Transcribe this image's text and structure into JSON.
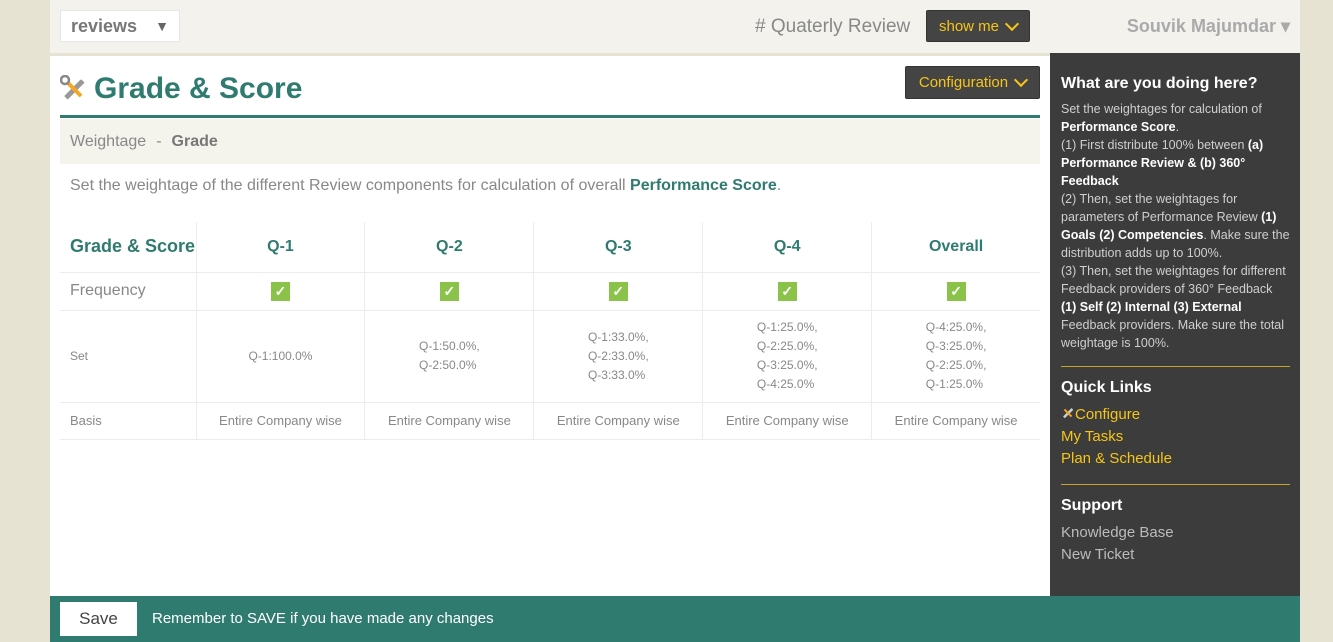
{
  "topbar": {
    "module_select": "reviews",
    "module_caret": "▼",
    "review_label": "# Quaterly Review",
    "showme_label": "show me",
    "user_name": "Souvik Majumdar ▾"
  },
  "page": {
    "title": "Grade & Score",
    "config_label": "Configuration",
    "breadcrumb": {
      "first": "Weightage",
      "sep": "-",
      "second": "Grade"
    },
    "desc_prefix": "Set the weightage of the different Review components for calculation of overall ",
    "desc_bold": "Performance Score",
    "desc_suffix": "."
  },
  "table": {
    "header": [
      "Grade & Score",
      "Q-1",
      "Q-2",
      "Q-3",
      "Q-4",
      "Overall"
    ],
    "rows": {
      "frequency": {
        "label": "Frequency",
        "checked": [
          true,
          true,
          true,
          true,
          true
        ]
      },
      "set": {
        "label": "Set",
        "cells": [
          [
            "Q-1:100.0%"
          ],
          [
            "Q-1:50.0%,",
            "Q-2:50.0%"
          ],
          [
            "Q-1:33.0%,",
            "Q-2:33.0%,",
            "Q-3:33.0%"
          ],
          [
            "Q-1:25.0%,",
            "Q-2:25.0%,",
            "Q-3:25.0%,",
            "Q-4:25.0%"
          ],
          [
            "Q-4:25.0%,",
            "Q-3:25.0%,",
            "Q-2:25.0%,",
            "Q-1:25.0%"
          ]
        ]
      },
      "basis": {
        "label": "Basis",
        "cells": [
          "Entire Company wise",
          "Entire Company wise",
          "Entire Company wise",
          "Entire Company wise",
          "Entire Company wise"
        ]
      }
    },
    "check_glyph": "✓"
  },
  "sidebar": {
    "help_title": "What are you doing here?",
    "help": {
      "p1a": "Set the weightages for calculation of ",
      "p1b": "Performance Score",
      "p1c": ".",
      "p2a": "(1) First distribute 100% between ",
      "p2b": "(a) Performance Review & (b) 360° Feedback",
      "p3a": "(2) Then, set the weightages for parameters of Performance Review ",
      "p3b": "(1) Goals (2) Competencies",
      "p3c": ". Make sure the distribution adds up to 100%.",
      "p4a": "(3) Then, set the weightages for different Feedback providers of 360° Feedback ",
      "p4b": "(1) Self (2) Internal (3) External",
      "p4c": " Feedback providers. Make sure the total weightage is 100%."
    },
    "quick_links_title": "Quick Links",
    "quick_links": [
      "Configure",
      "My Tasks",
      "Plan & Schedule"
    ],
    "support_title": "Support",
    "support_links": [
      "Knowledge Base",
      "New Ticket"
    ]
  },
  "footer": {
    "save_label": "Save",
    "message": "Remember to SAVE if you have made any changes"
  },
  "colors": {
    "accent": "#2f7b6f",
    "highlight": "#f5c518",
    "sidebar_bg": "#3c3c3c",
    "check": "#8bc34a"
  },
  "icons": {
    "title": "tools-icon",
    "check": "checkmark-icon",
    "chevron": "chevron-down-icon"
  }
}
